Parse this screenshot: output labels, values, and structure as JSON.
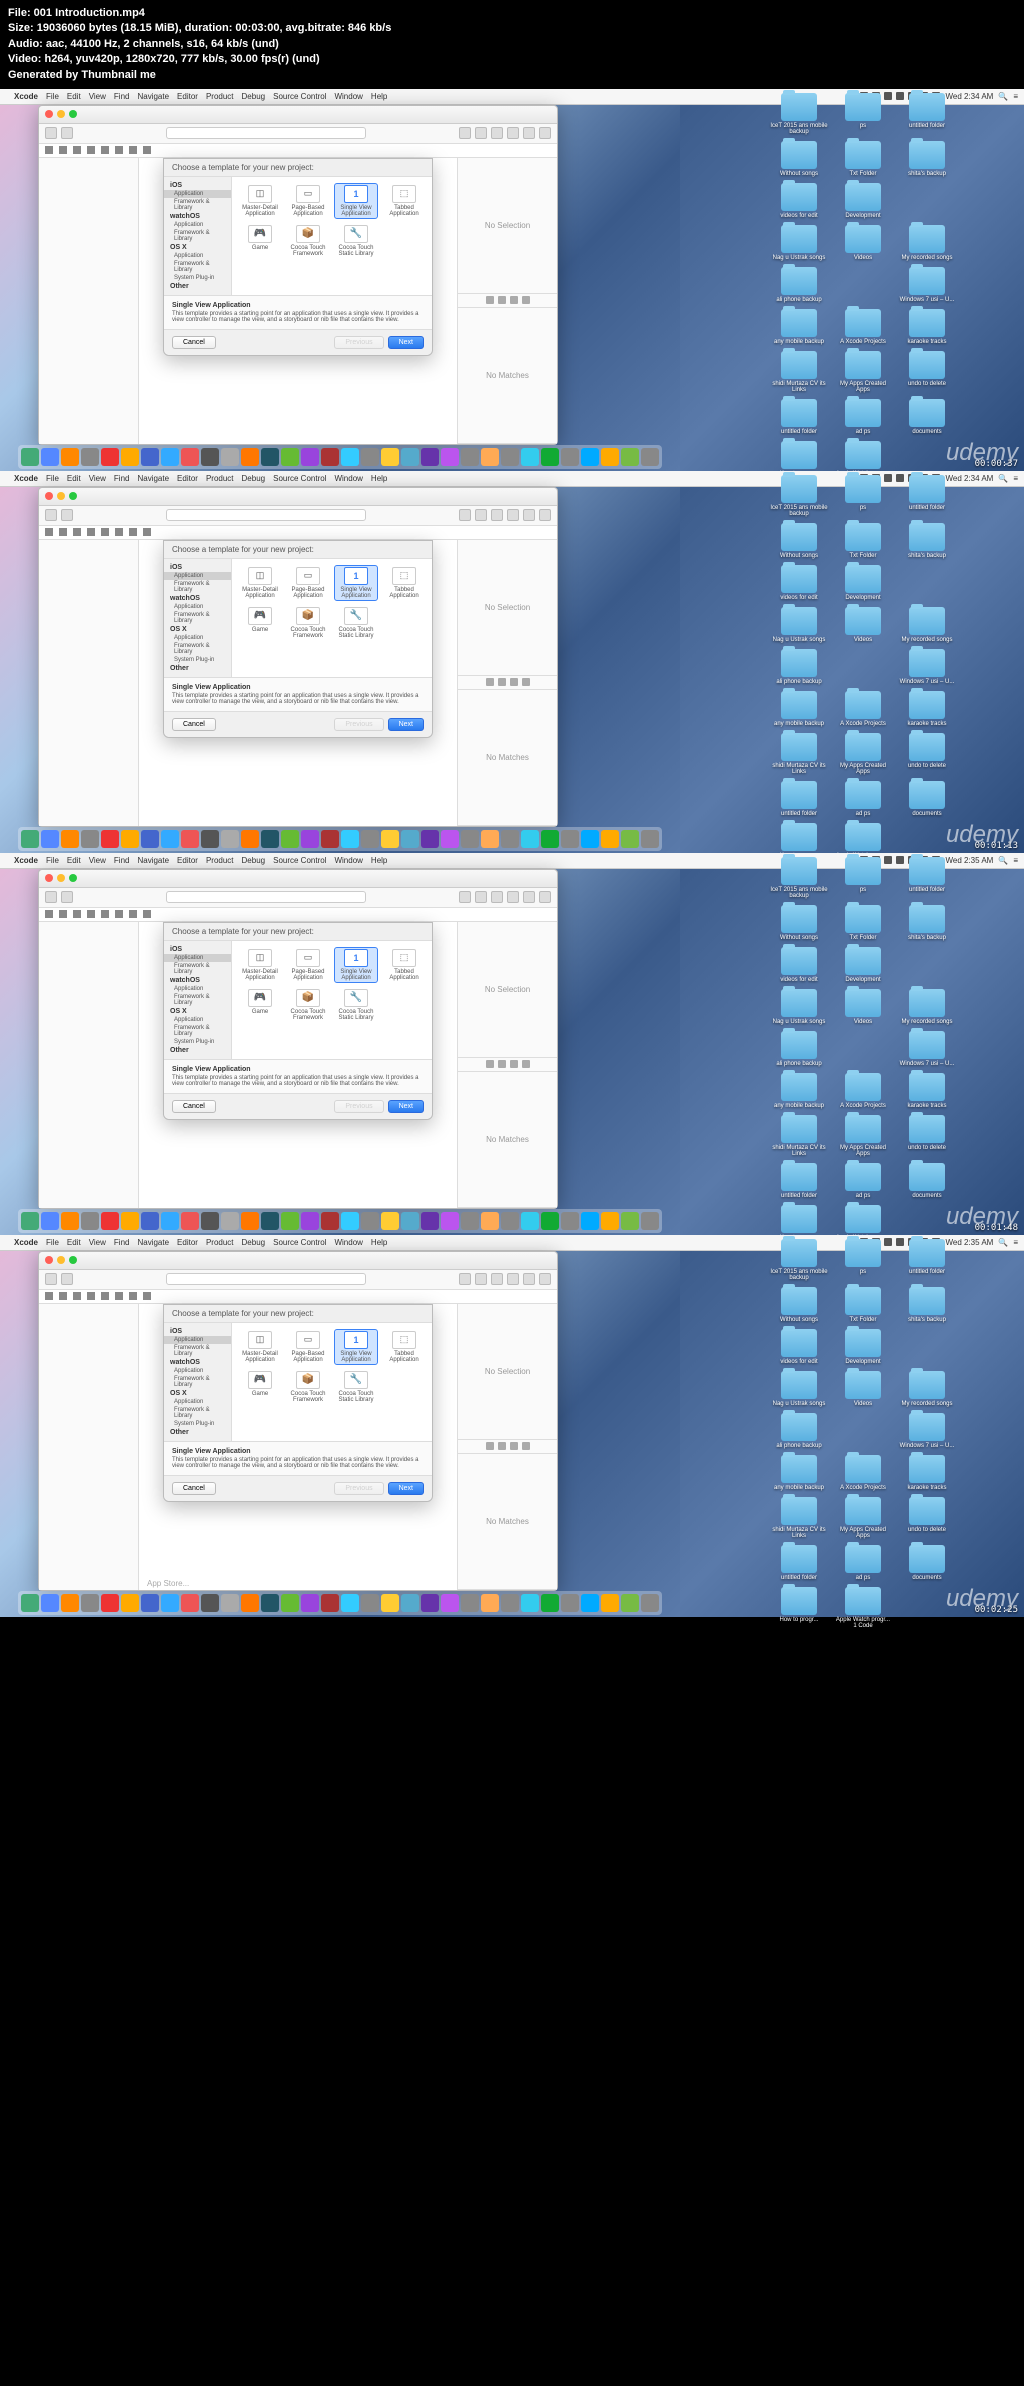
{
  "header": {
    "file": "File: 001 Introduction.mp4",
    "size": "Size: 19036060 bytes (18.15 MiB), duration: 00:03:00, avg.bitrate: 846 kb/s",
    "audio": "Audio: aac, 44100 Hz, 2 channels, s16, 64 kb/s (und)",
    "video": "Video: h264, yuv420p, 1280x720, 777 kb/s, 30.00 fps(r) (und)",
    "generated": "Generated by Thumbnail me"
  },
  "menubar": {
    "app": "Xcode",
    "items": [
      "File",
      "Edit",
      "View",
      "Find",
      "Navigate",
      "Editor",
      "Product",
      "Debug",
      "Source Control",
      "Window",
      "Help"
    ]
  },
  "clock": [
    {
      "time": "Wed 2:34 AM",
      "ts": "00:00:37"
    },
    {
      "time": "Wed 2:34 AM",
      "ts": "00:01:13"
    },
    {
      "time": "Wed 2:35 AM",
      "ts": "00:01:48"
    },
    {
      "time": "Wed 2:35 AM",
      "ts": "00:02:25"
    }
  ],
  "sheet": {
    "title": "Choose a template for your new project:",
    "sidebar": {
      "ios": "iOS",
      "application": "Application",
      "framework": "Framework & Library",
      "watchos": "watchOS",
      "osx": "OS X",
      "systemplugin": "System Plug-in",
      "other": "Other"
    },
    "templates": {
      "masterDetail": "Master-Detail Application",
      "pageBased": "Page-Based Application",
      "singleView": "Single View Application",
      "tabbed": "Tabbed Application",
      "game": "Game",
      "cocoaTouchFramework": "Cocoa Touch Framework",
      "cocoaTouchStatic": "Cocoa Touch Static Library"
    },
    "descTitle": "Single View Application",
    "descBody": "This template provides a starting point for an application that uses a single view. It provides a view controller to manage the view, and a storyboard or nib file that contains the view.",
    "cancel": "Cancel",
    "previous": "Previous",
    "next": "Next"
  },
  "rightPanel": {
    "noSelection": "No Selection",
    "noMatches": "No Matches"
  },
  "desktopFolders": [
    "IceT 2015 ans mobile backup",
    "ps",
    "untitled folder",
    "",
    "Without songs",
    "Txt Folder",
    "shita's backup",
    "",
    "videos for edit",
    "Development",
    "",
    "",
    "Nag u Ustrak songs",
    "Videos",
    "My recorded songs",
    "",
    "ali phone backup",
    "",
    "Windows 7 usi – U...",
    "",
    "any mobile backup",
    "A Xcode Projects",
    "karaoke tracks",
    "",
    "shidi Murtaza CV its Links",
    "My Apps Created Apps",
    "undo to delete",
    "",
    "untitled folder",
    "ad ps",
    "documents",
    "",
    "How to progr...",
    "Apple Watch progr... 1 Code",
    "",
    ""
  ],
  "watermark": "udemy",
  "appStore": "App Store...",
  "dockColors": [
    "#4a7",
    "#58f",
    "#f80",
    "#888",
    "#e33",
    "#fa0",
    "#46c",
    "#3af",
    "#e55",
    "#555",
    "#aaa",
    "#f70",
    "#256",
    "#6b3",
    "#94d",
    "#a33",
    "#3cf",
    "#888",
    "#fc3",
    "#5ac",
    "#63a",
    "#b5e",
    "#888",
    "#fa5",
    "#888",
    "#3ce",
    "#1a3",
    "#888",
    "#0af",
    "#fa0",
    "#7b4",
    "#888"
  ]
}
